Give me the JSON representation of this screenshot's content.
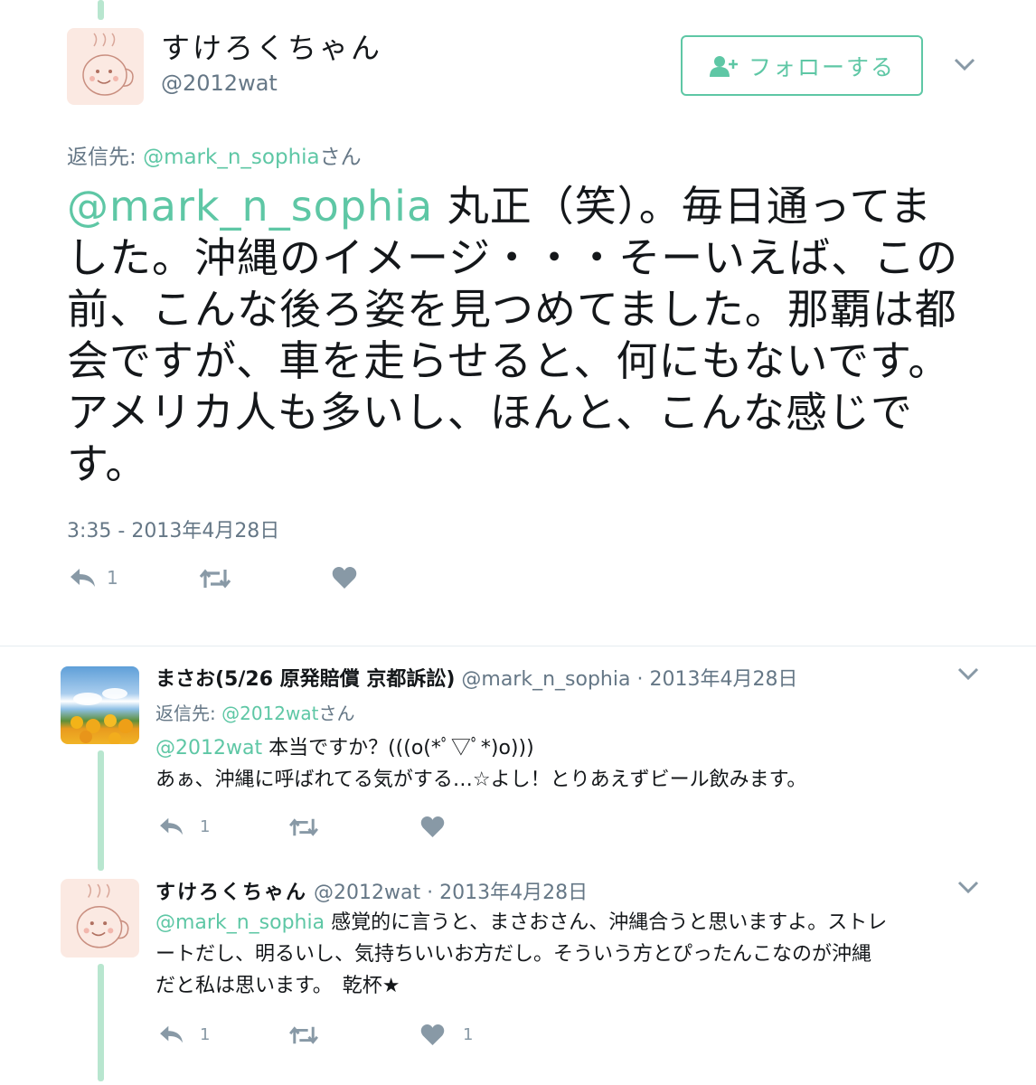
{
  "main_tweet": {
    "display_name": "すけろくちゃん",
    "handle": "@2012wat",
    "follow_label": "フォローする",
    "reply_to_prefix": "返信先: ",
    "reply_to_handle": "@mark_n_sophia",
    "reply_to_suffix": "さん",
    "mention": "@mark_n_sophia",
    "text": " 丸正（笑）。毎日通ってました。沖縄のイメージ・・・そーいえば、この前、こんな後ろ姿を見つめてました。那覇は都会ですが、車を走らせると、何にもないです。アメリカ人も多いし、ほんと、こんな感じです。",
    "timestamp": "3:35 - 2013年4月28日",
    "reply_count": "1"
  },
  "replies": [
    {
      "display_name": "まさお(5/26 原発賠償 京都訴訟)",
      "handle": "@mark_n_sophia",
      "date": "· 2013年4月28日",
      "reply_to_prefix": "返信先: ",
      "reply_to_handle": "@2012wat",
      "reply_to_suffix": "さん",
      "mention": "@2012wat",
      "line1": " 本当ですか？(((o(*ﾟ▽ﾟ*)o)))",
      "line2": "あぁ、沖縄に呼ばれてる気がする…☆よし！とりあえずビール飲みます。",
      "reply_count": "1",
      "like_count": ""
    },
    {
      "display_name": "すけろくちゃん",
      "handle": "@2012wat",
      "date": "· 2013年4月28日",
      "mention": "@mark_n_sophia",
      "line1": " 感覚的に言うと、まさおさん、沖縄合うと思いますよ。ストレ",
      "line2": "ートだし、明るいし、気持ちいいお方だし。そういう方とぴったんこなのが沖縄",
      "line3": "だと私は思います。　乾杯★",
      "reply_count": "1",
      "like_count": "1"
    }
  ],
  "colors": {
    "accent": "#5ec7a5",
    "muted": "#657786",
    "icon": "#8899a6",
    "thread_line": "#b8e6cf"
  },
  "icons": [
    "user-plus-icon",
    "chevron-down-icon",
    "reply-icon",
    "retweet-icon",
    "heart-icon"
  ]
}
